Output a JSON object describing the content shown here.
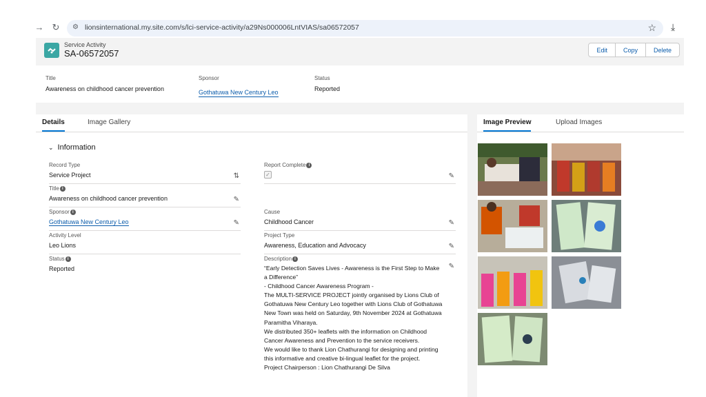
{
  "browser": {
    "url": "lionsinternational.my.site.com/s/lci-service-activity/a29Ns000006LntVIAS/sa06572057"
  },
  "record": {
    "type_label": "Service Activity",
    "name": "SA-06572057",
    "actions": [
      "Edit",
      "Copy",
      "Delete"
    ]
  },
  "highlights": {
    "title_label": "Title",
    "title_value": "Awareness on childhood cancer prevention",
    "sponsor_label": "Sponsor",
    "sponsor_value": "Gothatuwa New Century Leo",
    "status_label": "Status",
    "status_value": "Reported"
  },
  "tabs": {
    "details": "Details",
    "gallery": "Image Gallery",
    "preview": "Image Preview",
    "upload": "Upload Images"
  },
  "section": {
    "title": "Information"
  },
  "fields": {
    "record_type": {
      "label": "Record Type",
      "value": "Service Project"
    },
    "report_complete": {
      "label": "Report Complete",
      "checked": true
    },
    "title": {
      "label": "Title",
      "value": "Awareness on childhood cancer prevention"
    },
    "sponsor": {
      "label": "Sponsor",
      "value": "Gothatuwa New Century Leo"
    },
    "cause": {
      "label": "Cause",
      "value": "Childhood Cancer"
    },
    "activity_level": {
      "label": "Activity Level",
      "value": "Leo Lions"
    },
    "project_type": {
      "label": "Project Type",
      "value": "Awareness, Education and Advocacy"
    },
    "status": {
      "label": "Status",
      "value": "Reported"
    },
    "description": {
      "label": "Description",
      "value": "“Early Detection Saves Lives - Awareness is the First Step to Make a Difference”\n- Childhood Cancer Awareness Program -\nThe MULTI-SERVICE PROJECT jointly organised by Lions Club of Gothatuwa New Century Leo together with Lions Club of Gothatuwa New Town was held on Saturday, 9th November 2024 at Gothatuwa Paramitha Viharaya.\nWe distributed 350+ leaflets with the information on Childhood Cancer Awareness and Prevention to the service receivers.\nWe would like to thank Lion Chathurangi for designing and printing this informative and creative bi-lingual leaflet for the project.\nProject Chairperson : Lion Chathurangi De Silva"
    }
  },
  "colors": {
    "brand": "#3ba7a4",
    "link": "#0b5cab",
    "active_tab": "#0176d3"
  },
  "icons": [
    "back-arrow-icon",
    "reload-icon",
    "site-settings-icon",
    "star-icon",
    "download-icon",
    "service-activity-icon",
    "chevron-down-icon",
    "pencil-icon",
    "info-icon",
    "swap-icon",
    "checkbox-icon"
  ]
}
